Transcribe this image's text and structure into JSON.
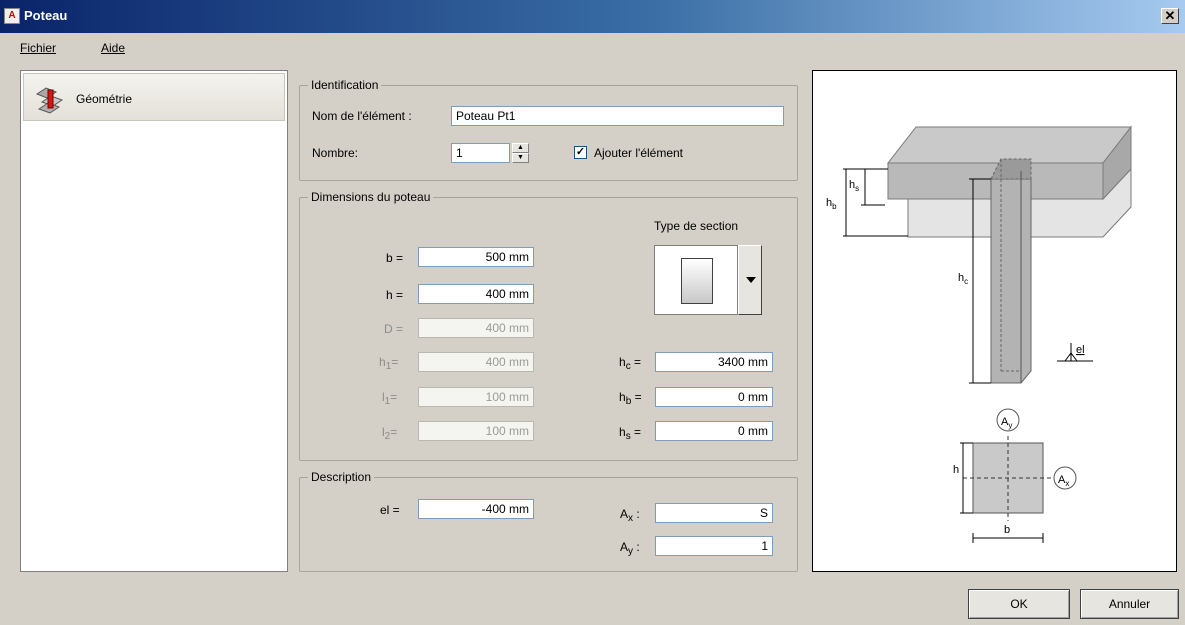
{
  "window": {
    "title": "Poteau",
    "app_icon_text": "A"
  },
  "menu": {
    "file": "Fichier",
    "help": "Aide"
  },
  "sidebar": {
    "items": [
      {
        "label": "Géométrie"
      }
    ]
  },
  "identification": {
    "legend": "Identification",
    "name_label": "Nom de l'élément :",
    "name_value": "Poteau Pt1",
    "count_label": "Nombre:",
    "count_value": "1",
    "add_label": "Ajouter l'élément",
    "add_checked": true
  },
  "dimensions": {
    "legend": "Dimensions du poteau",
    "section_type_label": "Type de section",
    "b": {
      "label": "b =",
      "value": "500 mm"
    },
    "h": {
      "label": "h =",
      "value": "400 mm"
    },
    "D": {
      "label": "D =",
      "value": "400 mm"
    },
    "h1": {
      "base": "h",
      "sub": "1",
      "eq": "=",
      "value": "400 mm"
    },
    "l1": {
      "base": "l",
      "sub": "1",
      "eq": "=",
      "value": "100 mm"
    },
    "l2": {
      "base": "l",
      "sub": "2",
      "eq": "=",
      "value": "100 mm"
    },
    "hc": {
      "base": "h",
      "sub": "c",
      "eq": " =",
      "value": "3400 mm"
    },
    "hb": {
      "base": "h",
      "sub": "b",
      "eq": " =",
      "value": "0 mm"
    },
    "hs": {
      "base": "h",
      "sub": "s",
      "eq": " =",
      "value": "0 mm"
    }
  },
  "description": {
    "legend": "Description",
    "el": {
      "label": "el =",
      "value": "-400 mm"
    },
    "ax": {
      "base": "A",
      "sub": "x",
      "eq": " :",
      "value": "S"
    },
    "ay": {
      "base": "A",
      "sub": "y",
      "eq": " :",
      "value": "1"
    }
  },
  "diagram": {
    "hb": "h",
    "hb_sub": "b",
    "hs": "h",
    "hs_sub": "s",
    "hc": "h",
    "hc_sub": "c",
    "el": "el",
    "Ay": "A",
    "Ay_sub": "y",
    "Ax": "A",
    "Ax_sub": "x",
    "h": "h",
    "b": "b"
  },
  "buttons": {
    "ok": "OK",
    "cancel": "Annuler"
  }
}
